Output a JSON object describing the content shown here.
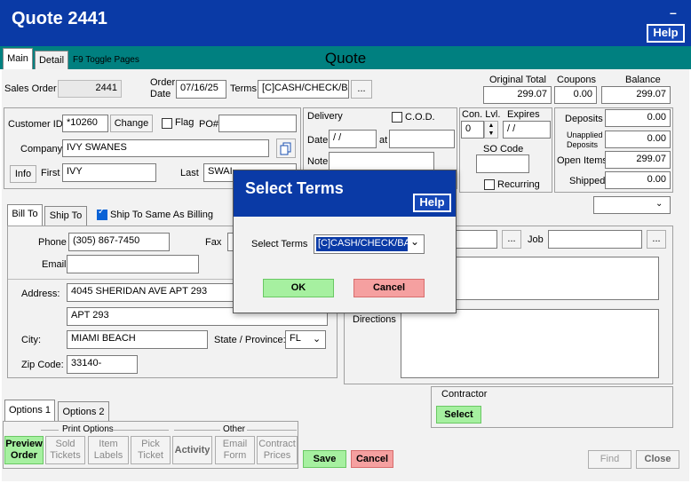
{
  "window": {
    "title": "Quote 2441",
    "minimize_glyph": "–",
    "help_label": "Help"
  },
  "tabs_top": {
    "main": "Main",
    "detail": "Detail",
    "toggle_hint": "F9 Toggle Pages",
    "section_title": "Quote"
  },
  "order": {
    "sales_order_label": "Sales Order",
    "sales_order_value": "2441",
    "order_date_label_1": "Order",
    "order_date_label_2": "Date",
    "order_date_value": "07/16/25",
    "terms_label": "Terms",
    "terms_value": "[C]CASH/CHECK/BA",
    "lookup_label": "..."
  },
  "totals": {
    "original_total_label": "Original Total",
    "original_total_value": "299.07",
    "coupons_label": "Coupons",
    "coupons_value": "0.00",
    "balance_label": "Balance",
    "balance_value": "299.07"
  },
  "customer": {
    "id_label": "Customer ID",
    "id_value": "*10260",
    "change_label": "Change",
    "flag_label": "Flag",
    "po_label": "PO#",
    "po_value": "",
    "company_label": "Company",
    "company_value": "IVY SWANES",
    "info_label": "Info",
    "first_label": "First",
    "first_value": "IVY",
    "last_label": "Last",
    "last_value": "SWAI"
  },
  "delivery": {
    "title": "Delivery",
    "cod_label": "C.O.D.",
    "date_label": "Date",
    "date_value": " /  /",
    "at_label": "at",
    "at_value": "",
    "note_label": "Note",
    "note_value": ""
  },
  "conlvl": {
    "label": "Con. Lvl.",
    "value": "0",
    "expires_label": "Expires",
    "expires_value": " /  /",
    "so_code_label": "SO Code",
    "so_code_value": "",
    "recurring_label": "Recurring"
  },
  "deposits": {
    "deposits_label": "Deposits",
    "deposits_value": "0.00",
    "unapplied_label_1": "Unapplied",
    "unapplied_label_2": "Deposits",
    "unapplied_value": "0.00",
    "open_items_label": "Open Items",
    "open_items_value": "299.07",
    "shipped_label": "Shipped",
    "shipped_value": "0.00"
  },
  "billto": {
    "tab_bill": "Bill To",
    "tab_ship": "Ship To",
    "same_label": "Ship To Same As Billing",
    "phone_label": "Phone",
    "phone_value": "(305) 867-7450",
    "fax_label": "Fax",
    "email_label": "Email",
    "email_value": "",
    "address_label": "Address:",
    "address1": "4045 SHERIDAN AVE APT 293",
    "address2": "APT 293",
    "city_label": "City:",
    "city_value": "MIAMI BEACH",
    "state_label": "State / Province:",
    "state_value": "FL",
    "zip_label": "Zip Code:",
    "zip_value": "33140-"
  },
  "right_panel": {
    "job_label": "Job",
    "directions_label": "Directions"
  },
  "contractor": {
    "label": "Contractor",
    "select_label": "Select"
  },
  "options": {
    "tab1": "Options 1",
    "tab2": "Options 2",
    "print_options": "Print Options",
    "other": "Other",
    "preview_1": "Preview",
    "preview_2": "Order",
    "sold_1": "Sold",
    "sold_2": "Tickets",
    "item_1": "Item",
    "item_2": "Labels",
    "pick_1": "Pick",
    "pick_2": "Ticket",
    "activity": "Activity",
    "email_1": "Email",
    "email_2": "Form",
    "contract_1": "Contract",
    "contract_2": "Prices"
  },
  "bottom": {
    "save": "Save",
    "cancel": "Cancel",
    "find": "Find",
    "close": "Close"
  },
  "dialog": {
    "title": "Select Terms",
    "help_label": "Help",
    "select_label": "Select Terms",
    "select_value": "[C]CASH/CHECK/BAN",
    "ok": "OK",
    "cancel": "Cancel"
  }
}
